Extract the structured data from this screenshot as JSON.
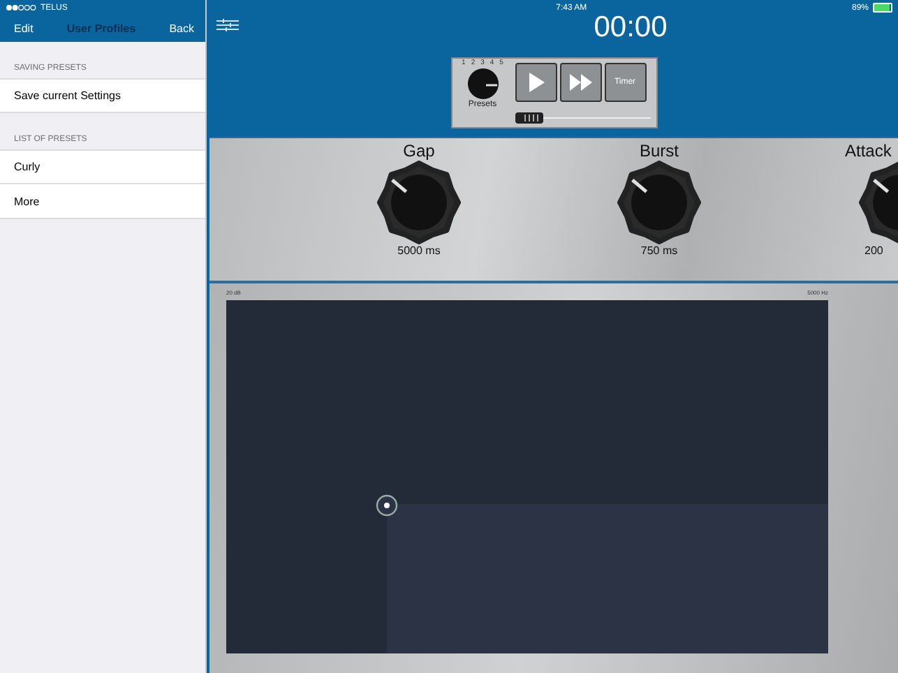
{
  "status_bar": {
    "carrier": "TELUS",
    "time": "7:43 AM",
    "battery": "89%"
  },
  "sidebar": {
    "nav": {
      "left": "Edit",
      "title": "User Profiles",
      "right": "Back"
    },
    "sections": [
      {
        "header": "SAVING PRESETS",
        "items": [
          "Save current Settings"
        ]
      },
      {
        "header": "LIST OF PRESETS",
        "items": [
          "Curly",
          "More"
        ]
      }
    ]
  },
  "main": {
    "timer": "00:00",
    "controls": {
      "presets_label": "Presets",
      "dial_marks": [
        "1",
        "2",
        "3",
        "4",
        "5"
      ],
      "timer_button": "Timer"
    },
    "knobs": [
      {
        "label": "Gap",
        "value": "5000 ms"
      },
      {
        "label": "Burst",
        "value": "750 ms"
      },
      {
        "label": "Attack",
        "value": "200"
      }
    ],
    "graph": {
      "y_label": "20 dB",
      "x_label": "5000 Hz"
    }
  }
}
